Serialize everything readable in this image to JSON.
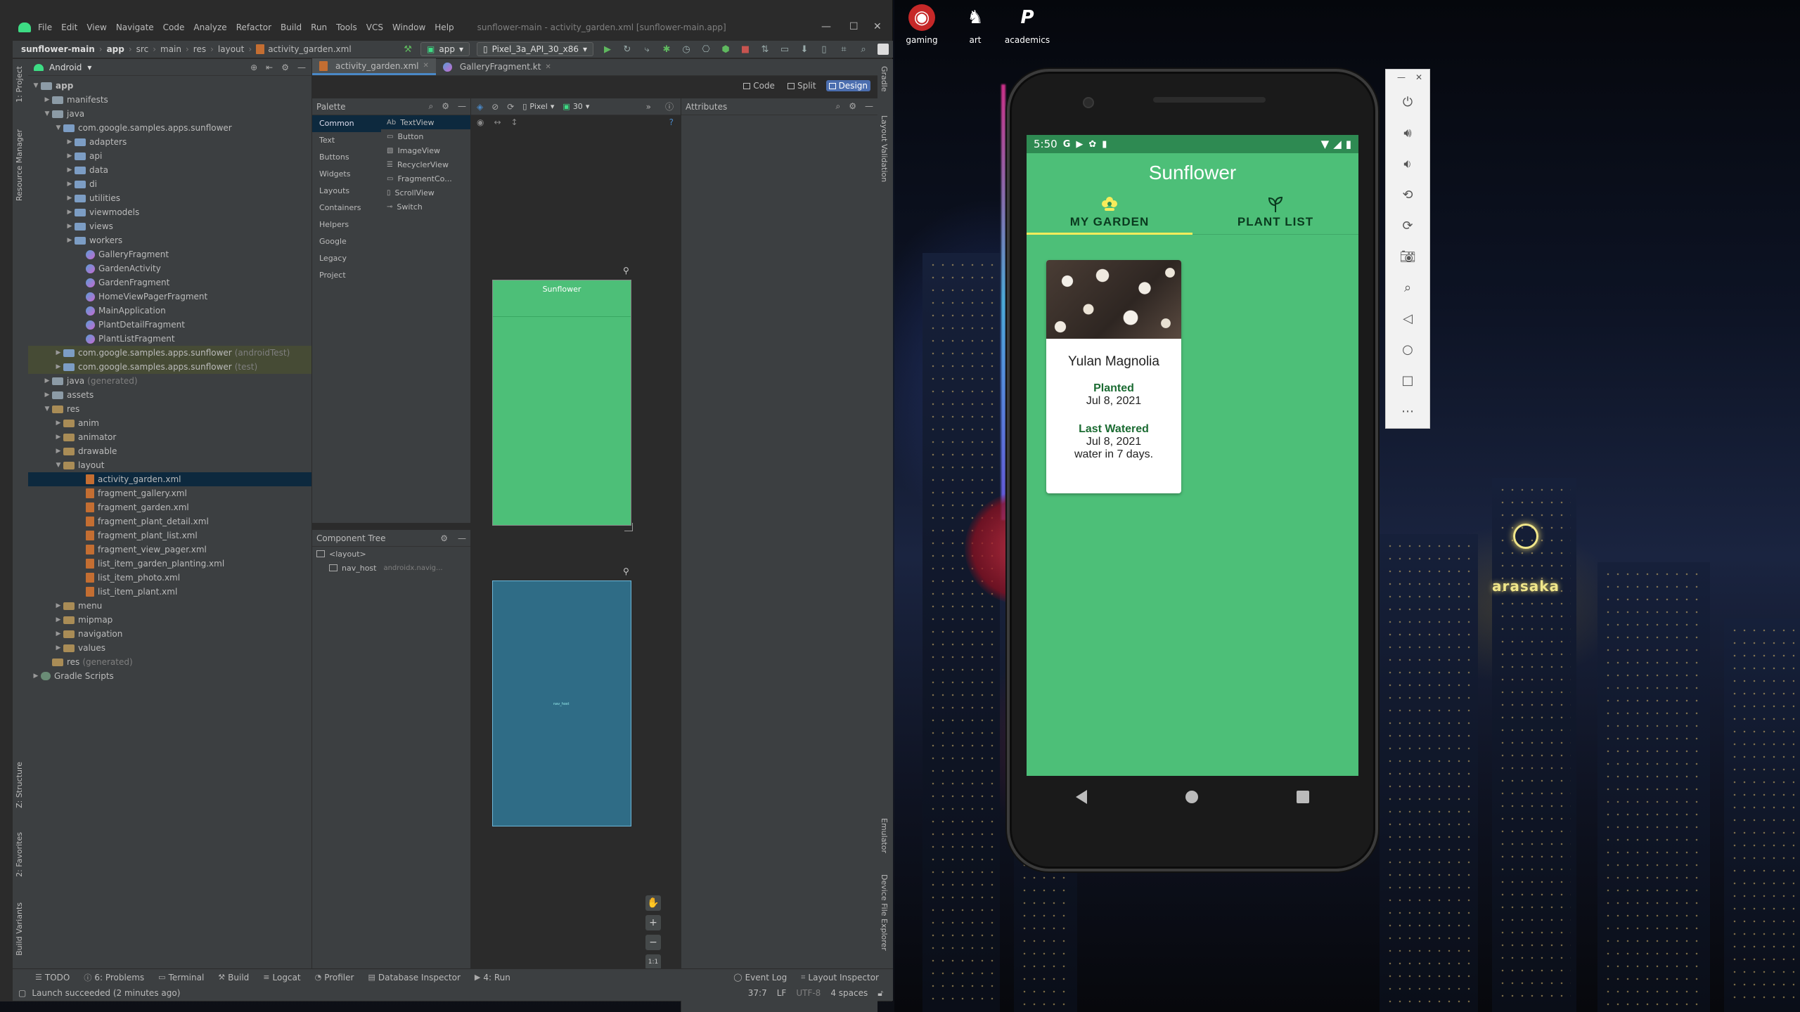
{
  "desktop": {
    "icons": [
      {
        "label": "gaming",
        "icon": "gaming-app-icon"
      },
      {
        "label": "art",
        "icon": "art-app-icon"
      },
      {
        "label": "academics",
        "icon": "academics-app-icon",
        "glyph": "P"
      }
    ],
    "brand_text": "arasaka"
  },
  "ide": {
    "menu": [
      "File",
      "Edit",
      "View",
      "Navigate",
      "Code",
      "Analyze",
      "Refactor",
      "Build",
      "Run",
      "Tools",
      "VCS",
      "Window",
      "Help"
    ],
    "window_title": "sunflower-main - activity_garden.xml [sunflower-main.app]",
    "breadcrumbs": [
      "sunflower-main",
      "app",
      "src",
      "main",
      "res",
      "layout",
      "activity_garden.xml"
    ],
    "run_config": "app",
    "device": "Pixel_3a_API_30_x86",
    "project_view": "Android",
    "tree": [
      {
        "label": "app",
        "depth": 0,
        "icon": "folder",
        "open": true,
        "bold": true
      },
      {
        "label": "manifests",
        "depth": 1,
        "icon": "folder",
        "open": false
      },
      {
        "label": "java",
        "depth": 1,
        "icon": "folder",
        "open": true
      },
      {
        "label": "com.google.samples.apps.sunflower",
        "depth": 2,
        "icon": "folder-src",
        "open": true
      },
      {
        "label": "adapters",
        "depth": 3,
        "icon": "folder-src",
        "open": false
      },
      {
        "label": "api",
        "depth": 3,
        "icon": "folder-src",
        "open": false
      },
      {
        "label": "data",
        "depth": 3,
        "icon": "folder-src",
        "open": false
      },
      {
        "label": "di",
        "depth": 3,
        "icon": "folder-src",
        "open": false
      },
      {
        "label": "utilities",
        "depth": 3,
        "icon": "folder-src",
        "open": false
      },
      {
        "label": "viewmodels",
        "depth": 3,
        "icon": "folder-src",
        "open": false
      },
      {
        "label": "views",
        "depth": 3,
        "icon": "folder-src",
        "open": false
      },
      {
        "label": "workers",
        "depth": 3,
        "icon": "folder-src",
        "open": false
      },
      {
        "label": "GalleryFragment",
        "depth": 4,
        "icon": "kotlin"
      },
      {
        "label": "GardenActivity",
        "depth": 4,
        "icon": "kotlin"
      },
      {
        "label": "GardenFragment",
        "depth": 4,
        "icon": "kotlin"
      },
      {
        "label": "HomeViewPagerFragment",
        "depth": 4,
        "icon": "kotlin"
      },
      {
        "label": "MainApplication",
        "depth": 4,
        "icon": "kotlin"
      },
      {
        "label": "PlantDetailFragment",
        "depth": 4,
        "icon": "kotlin"
      },
      {
        "label": "PlantListFragment",
        "depth": 4,
        "icon": "kotlin"
      },
      {
        "label": "com.google.samples.apps.sunflower",
        "suffix": "(androidTest)",
        "depth": 2,
        "icon": "folder-src",
        "open": false,
        "hl": true
      },
      {
        "label": "com.google.samples.apps.sunflower",
        "suffix": "(test)",
        "depth": 2,
        "icon": "folder-src",
        "open": false,
        "hl": true
      },
      {
        "label": "java",
        "suffix": "(generated)",
        "depth": 1,
        "icon": "folder",
        "open": false
      },
      {
        "label": "assets",
        "depth": 1,
        "icon": "folder",
        "open": false
      },
      {
        "label": "res",
        "depth": 1,
        "icon": "folder-res",
        "open": true
      },
      {
        "label": "anim",
        "depth": 2,
        "icon": "folder-res",
        "open": false
      },
      {
        "label": "animator",
        "depth": 2,
        "icon": "folder-res",
        "open": false
      },
      {
        "label": "drawable",
        "depth": 2,
        "icon": "folder-res",
        "open": false
      },
      {
        "label": "layout",
        "depth": 2,
        "icon": "folder-res",
        "open": true
      },
      {
        "label": "activity_garden.xml",
        "depth": 4,
        "icon": "xml",
        "selected": true
      },
      {
        "label": "fragment_gallery.xml",
        "depth": 4,
        "icon": "xml"
      },
      {
        "label": "fragment_garden.xml",
        "depth": 4,
        "icon": "xml"
      },
      {
        "label": "fragment_plant_detail.xml",
        "depth": 4,
        "icon": "xml"
      },
      {
        "label": "fragment_plant_list.xml",
        "depth": 4,
        "icon": "xml"
      },
      {
        "label": "fragment_view_pager.xml",
        "depth": 4,
        "icon": "xml"
      },
      {
        "label": "list_item_garden_planting.xml",
        "depth": 4,
        "icon": "xml"
      },
      {
        "label": "list_item_photo.xml",
        "depth": 4,
        "icon": "xml"
      },
      {
        "label": "list_item_plant.xml",
        "depth": 4,
        "icon": "xml"
      },
      {
        "label": "menu",
        "depth": 2,
        "icon": "folder-res",
        "open": false
      },
      {
        "label": "mipmap",
        "depth": 2,
        "icon": "folder-res",
        "open": false
      },
      {
        "label": "navigation",
        "depth": 2,
        "icon": "folder-res",
        "open": false
      },
      {
        "label": "values",
        "depth": 2,
        "icon": "folder-res",
        "open": false
      },
      {
        "label": "res",
        "suffix": "(generated)",
        "depth": 1,
        "icon": "folder-res"
      },
      {
        "label": "Gradle Scripts",
        "depth": 0,
        "icon": "gradle",
        "open": false
      }
    ],
    "editor_tabs": [
      {
        "label": "activity_garden.xml",
        "active": true
      },
      {
        "label": "GalleryFragment.kt",
        "active": false
      }
    ],
    "view_modes": [
      {
        "label": "Code",
        "on": false
      },
      {
        "label": "Split",
        "on": false
      },
      {
        "label": "Design",
        "on": true
      }
    ],
    "palette": {
      "title": "Palette",
      "categories": [
        "Common",
        "Text",
        "Buttons",
        "Widgets",
        "Layouts",
        "Containers",
        "Helpers",
        "Google",
        "Legacy",
        "Project"
      ],
      "items": [
        "TextView",
        "Button",
        "ImageView",
        "RecyclerView",
        "FragmentCo...",
        "ScrollView",
        "Switch"
      ]
    },
    "design_toolbar": {
      "device": "Pixel",
      "api": "30"
    },
    "design_preview_title": "Sunflower",
    "blueprint_label": "nav_host",
    "component_tree": {
      "title": "Component Tree",
      "rows": [
        {
          "label": "<layout>",
          "depth": 0,
          "sub": ""
        },
        {
          "label": "nav_host",
          "depth": 1,
          "sub": "androidx.navig..."
        }
      ]
    },
    "zoom": {
      "ratio": "1:1"
    },
    "attributes_title": "Attributes",
    "left_tool_tabs": [
      "1: Project",
      "Resource Manager",
      "Z: Structure",
      "2: Favorites",
      "Build Variants"
    ],
    "right_tool_tabs": [
      "Gradle",
      "Layout Validation",
      "Emulator",
      "Device File Explorer"
    ],
    "bottom_tools": [
      "TODO",
      "6: Problems",
      "Terminal",
      "Build",
      "Logcat",
      "Profiler",
      "Database Inspector",
      "4: Run"
    ],
    "bottom_tools_right": [
      "Event Log",
      "Layout Inspector"
    ],
    "status": {
      "message": "Launch succeeded (2 minutes ago)",
      "position": "37:7",
      "line_sep": "LF",
      "encoding": "UTF-8",
      "indent": "4 spaces"
    }
  },
  "emulator": {
    "time": "5:50",
    "app_title": "Sunflower",
    "tabs": [
      {
        "label": "MY GARDEN",
        "on": true,
        "icon": "flower-icon"
      },
      {
        "label": "PLANT LIST",
        "on": false,
        "icon": "sprout-icon"
      }
    ],
    "card": {
      "name": "Yulan Magnolia",
      "planted_label": "Planted",
      "planted_date": "Jul 8, 2021",
      "watered_label": "Last Watered",
      "watered_date": "Jul 8, 2021",
      "water_next": "water in 7 days."
    },
    "colors": {
      "primary": "#4dbf78",
      "primary_dark": "#2e8a52",
      "accent": "#f7ec5b",
      "label_green": "#1b6b32"
    }
  },
  "emulator_side": {
    "buttons": [
      "power-icon",
      "volume-up-icon",
      "volume-down-icon",
      "rotate-left-icon",
      "rotate-right-icon",
      "camera-icon",
      "zoom-icon",
      "back-icon",
      "home-icon",
      "overview-icon",
      "more-icon"
    ]
  }
}
